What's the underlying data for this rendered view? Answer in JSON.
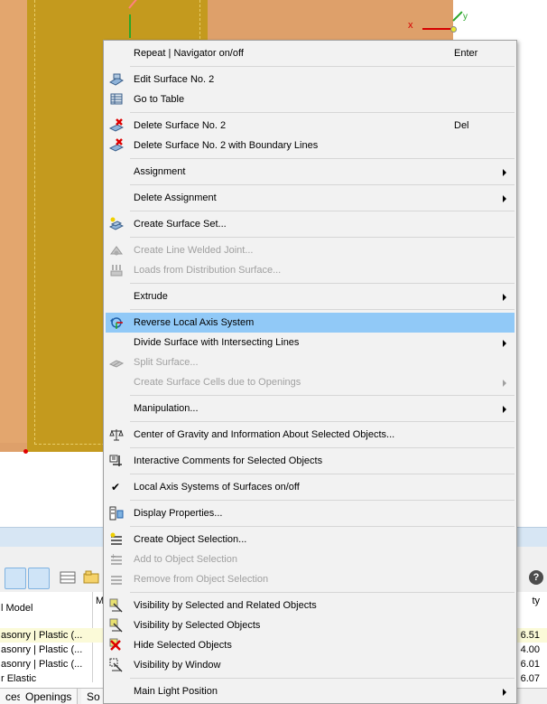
{
  "viewport": {
    "axis_x_label": "x",
    "axis_y_label": "y"
  },
  "context_menu": {
    "items": [
      {
        "label": "Repeat | Navigator on/off",
        "shortcut": "Enter"
      },
      {
        "label": "Edit Surface No. 2",
        "icon": "edit-surface-icon"
      },
      {
        "label": "Go to Table",
        "icon": "table-icon"
      },
      {
        "label": "Delete Surface No. 2",
        "shortcut": "Del",
        "icon": "delete-icon"
      },
      {
        "label": "Delete Surface No. 2 with Boundary Lines",
        "icon": "delete-icon"
      },
      {
        "label": "Assignment",
        "submenu": true
      },
      {
        "label": "Delete Assignment",
        "submenu": true
      },
      {
        "label": "Create Surface Set...",
        "icon": "surface-set-icon"
      },
      {
        "label": "Create Line Welded Joint...",
        "disabled": true,
        "icon": "welded-joint-icon"
      },
      {
        "label": "Loads from Distribution Surface...",
        "disabled": true,
        "icon": "distribution-loads-icon"
      },
      {
        "label": "Extrude",
        "submenu": true
      },
      {
        "label": "Reverse Local Axis System",
        "highlighted": true,
        "icon": "reverse-axis-icon"
      },
      {
        "label": "Divide Surface with Intersecting Lines",
        "submenu": true
      },
      {
        "label": "Split Surface...",
        "disabled": true,
        "icon": "split-surface-icon"
      },
      {
        "label": "Create Surface Cells due to Openings",
        "disabled": true,
        "submenu": true
      },
      {
        "label": "Manipulation...",
        "submenu": true
      },
      {
        "label": "Center of Gravity and Information About Selected Objects...",
        "icon": "balance-scale-icon"
      },
      {
        "label": "Interactive Comments for Selected Objects",
        "icon": "comments-icon"
      },
      {
        "label": "Local Axis Systems of Surfaces on/off",
        "checked": true
      },
      {
        "label": "Display Properties...",
        "icon": "display-properties-icon"
      },
      {
        "label": "Create Object Selection...",
        "icon": "object-selection-icon"
      },
      {
        "label": "Add to Object Selection",
        "disabled": true,
        "icon": "add-selection-icon"
      },
      {
        "label": "Remove from Object Selection",
        "disabled": true,
        "icon": "remove-selection-icon"
      },
      {
        "label": "Visibility by Selected and Related Objects",
        "icon": "visibility-related-icon"
      },
      {
        "label": "Visibility by Selected Objects",
        "icon": "visibility-selected-icon"
      },
      {
        "label": "Hide Selected Objects",
        "icon": "hide-objects-icon"
      },
      {
        "label": "Visibility by Window",
        "icon": "visibility-window-icon"
      },
      {
        "label": "Main Light Position",
        "submenu": true
      }
    ]
  },
  "table": {
    "header_left": "l Model",
    "header_mid": "M",
    "header_right": "ty",
    "rows": [
      {
        "left": "asonry | Plastic (...",
        "right": "6.51"
      },
      {
        "left": "asonry | Plastic (...",
        "right": "4.00"
      },
      {
        "left": "asonry | Plastic (...",
        "right": "6.01"
      },
      {
        "left": "r Elastic",
        "right": "6.07"
      }
    ]
  },
  "tabs": [
    "ces",
    "Openings",
    "So"
  ],
  "help_label": "?"
}
